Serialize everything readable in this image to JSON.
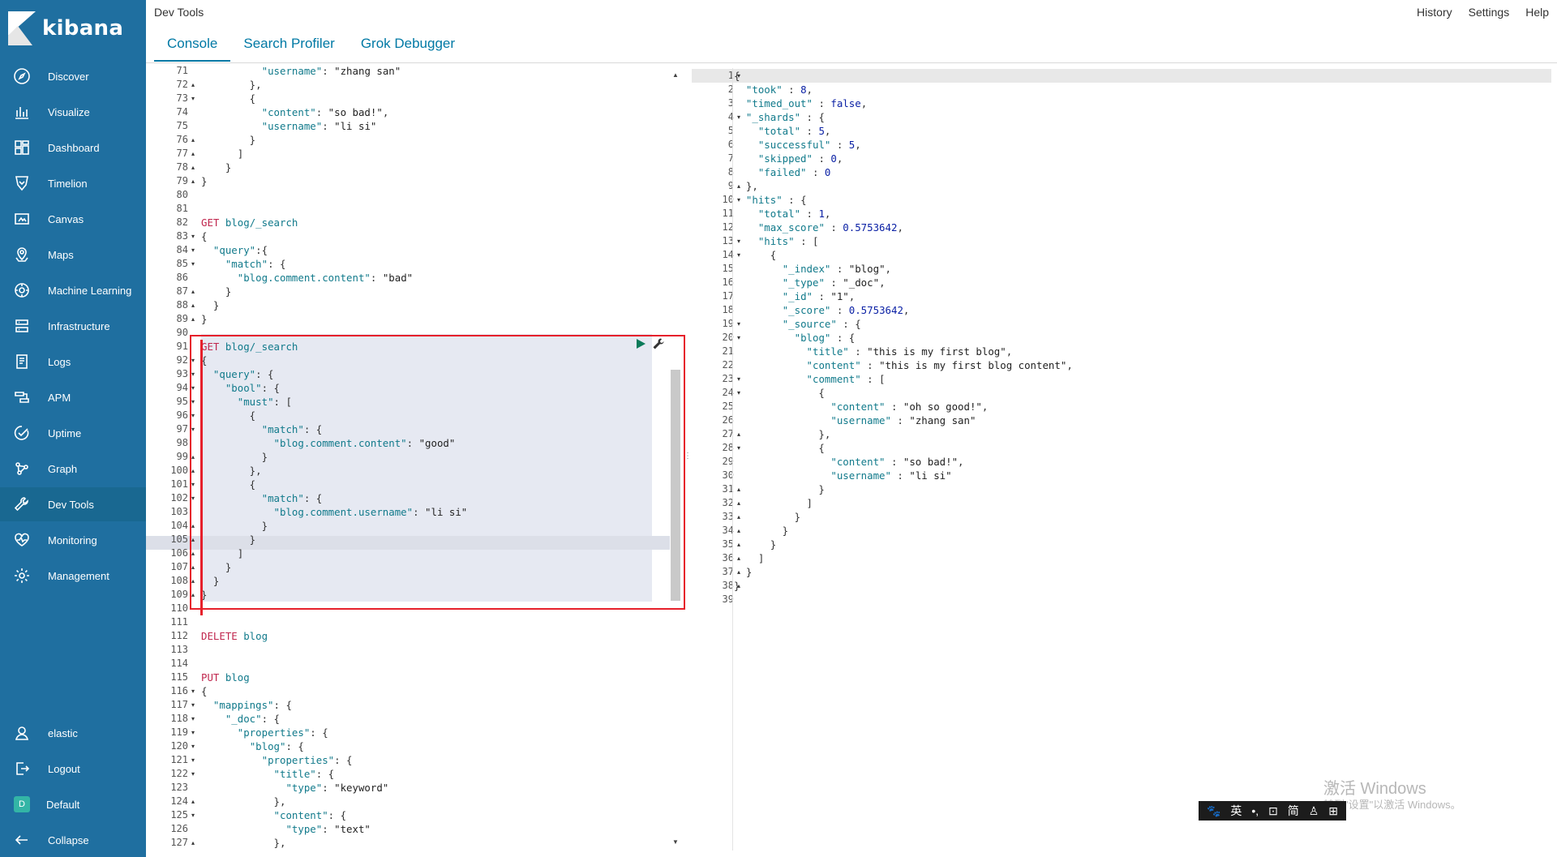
{
  "app": {
    "logo_text": "kibana",
    "section_title": "Dev Tools"
  },
  "header": {
    "links": [
      "History",
      "Settings",
      "Help"
    ],
    "tabs": [
      "Console",
      "Search Profiler",
      "Grok Debugger"
    ],
    "active_tab": "Console"
  },
  "sidebar": {
    "items": [
      {
        "label": "Discover",
        "icon": "compass-icon"
      },
      {
        "label": "Visualize",
        "icon": "chart-icon"
      },
      {
        "label": "Dashboard",
        "icon": "dashboard-icon"
      },
      {
        "label": "Timelion",
        "icon": "timelion-icon"
      },
      {
        "label": "Canvas",
        "icon": "canvas-icon"
      },
      {
        "label": "Maps",
        "icon": "map-icon"
      },
      {
        "label": "Machine Learning",
        "icon": "ml-icon"
      },
      {
        "label": "Infrastructure",
        "icon": "infrastructure-icon"
      },
      {
        "label": "Logs",
        "icon": "logs-icon"
      },
      {
        "label": "APM",
        "icon": "apm-icon"
      },
      {
        "label": "Uptime",
        "icon": "uptime-icon"
      },
      {
        "label": "Graph",
        "icon": "graph-icon"
      },
      {
        "label": "Dev Tools",
        "icon": "wrench-icon",
        "active": true
      },
      {
        "label": "Monitoring",
        "icon": "heartbeat-icon"
      },
      {
        "label": "Management",
        "icon": "gear-icon"
      }
    ],
    "bottom_items": [
      {
        "label": "elastic",
        "icon": "user-icon"
      },
      {
        "label": "Logout",
        "icon": "logout-icon"
      },
      {
        "label": "Default",
        "icon": "space-badge",
        "badge": "D"
      },
      {
        "label": "Collapse",
        "icon": "arrow-left-icon"
      }
    ]
  },
  "request_editor": {
    "lines": [
      {
        "n": "71",
        "f": "",
        "t": "          \"username\": \"zhang san\""
      },
      {
        "n": "72",
        "f": "▴",
        "t": "        },"
      },
      {
        "n": "73",
        "f": "▾",
        "t": "        {"
      },
      {
        "n": "74",
        "f": "",
        "t": "          \"content\": \"so bad!\","
      },
      {
        "n": "75",
        "f": "",
        "t": "          \"username\": \"li si\""
      },
      {
        "n": "76",
        "f": "▴",
        "t": "        }"
      },
      {
        "n": "77",
        "f": "▴",
        "t": "      ]"
      },
      {
        "n": "78",
        "f": "▴",
        "t": "    }"
      },
      {
        "n": "79",
        "f": "▴",
        "t": "}"
      },
      {
        "n": "80",
        "f": "",
        "t": ""
      },
      {
        "n": "81",
        "f": "",
        "t": ""
      },
      {
        "n": "82",
        "f": "",
        "t": "GET blog/_search"
      },
      {
        "n": "83",
        "f": "▾",
        "t": "{"
      },
      {
        "n": "84",
        "f": "▾",
        "t": "  \"query\":{"
      },
      {
        "n": "85",
        "f": "▾",
        "t": "    \"match\": {"
      },
      {
        "n": "86",
        "f": "",
        "t": "      \"blog.comment.content\": \"bad\""
      },
      {
        "n": "87",
        "f": "▴",
        "t": "    }"
      },
      {
        "n": "88",
        "f": "▴",
        "t": "  }"
      },
      {
        "n": "89",
        "f": "▴",
        "t": "}"
      },
      {
        "n": "90",
        "f": "",
        "t": ""
      },
      {
        "n": "91",
        "f": "",
        "t": "GET blog/_search"
      },
      {
        "n": "92",
        "f": "▾",
        "t": "{"
      },
      {
        "n": "93",
        "f": "▾",
        "t": "  \"query\": {"
      },
      {
        "n": "94",
        "f": "▾",
        "t": "    \"bool\": {"
      },
      {
        "n": "95",
        "f": "▾",
        "t": "      \"must\": ["
      },
      {
        "n": "96",
        "f": "▾",
        "t": "        {"
      },
      {
        "n": "97",
        "f": "▾",
        "t": "          \"match\": {"
      },
      {
        "n": "98",
        "f": "",
        "t": "            \"blog.comment.content\": \"good\""
      },
      {
        "n": "99",
        "f": "▴",
        "t": "          }"
      },
      {
        "n": "100",
        "f": "▴",
        "t": "        },"
      },
      {
        "n": "101",
        "f": "▾",
        "t": "        {"
      },
      {
        "n": "102",
        "f": "▾",
        "t": "          \"match\": {"
      },
      {
        "n": "103",
        "f": "",
        "t": "            \"blog.comment.username\": \"li si\""
      },
      {
        "n": "104",
        "f": "▴",
        "t": "          }"
      },
      {
        "n": "105",
        "f": "▴",
        "t": "        }"
      },
      {
        "n": "106",
        "f": "▴",
        "t": "      ]"
      },
      {
        "n": "107",
        "f": "▴",
        "t": "    }"
      },
      {
        "n": "108",
        "f": "▴",
        "t": "  }"
      },
      {
        "n": "109",
        "f": "▴",
        "t": "}"
      },
      {
        "n": "110",
        "f": "",
        "t": ""
      },
      {
        "n": "111",
        "f": "",
        "t": ""
      },
      {
        "n": "112",
        "f": "",
        "t": "DELETE blog"
      },
      {
        "n": "113",
        "f": "",
        "t": ""
      },
      {
        "n": "114",
        "f": "",
        "t": ""
      },
      {
        "n": "115",
        "f": "",
        "t": "PUT blog"
      },
      {
        "n": "116",
        "f": "▾",
        "t": "{"
      },
      {
        "n": "117",
        "f": "▾",
        "t": "  \"mappings\": {"
      },
      {
        "n": "118",
        "f": "▾",
        "t": "    \"_doc\": {"
      },
      {
        "n": "119",
        "f": "▾",
        "t": "      \"properties\": {"
      },
      {
        "n": "120",
        "f": "▾",
        "t": "        \"blog\": {"
      },
      {
        "n": "121",
        "f": "▾",
        "t": "          \"properties\": {"
      },
      {
        "n": "122",
        "f": "▾",
        "t": "            \"title\": {"
      },
      {
        "n": "123",
        "f": "",
        "t": "              \"type\": \"keyword\""
      },
      {
        "n": "124",
        "f": "▴",
        "t": "            },"
      },
      {
        "n": "125",
        "f": "▾",
        "t": "            \"content\": {"
      },
      {
        "n": "126",
        "f": "",
        "t": "              \"type\": \"text\""
      },
      {
        "n": "127",
        "f": "▴",
        "t": "            },"
      }
    ]
  },
  "response_viewer": {
    "lines": [
      {
        "n": "1",
        "f": "▾",
        "t": "{"
      },
      {
        "n": "2",
        "f": "",
        "t": "  \"took\" : 8,"
      },
      {
        "n": "3",
        "f": "",
        "t": "  \"timed_out\" : false,"
      },
      {
        "n": "4",
        "f": "▾",
        "t": "  \"_shards\" : {"
      },
      {
        "n": "5",
        "f": "",
        "t": "    \"total\" : 5,"
      },
      {
        "n": "6",
        "f": "",
        "t": "    \"successful\" : 5,"
      },
      {
        "n": "7",
        "f": "",
        "t": "    \"skipped\" : 0,"
      },
      {
        "n": "8",
        "f": "",
        "t": "    \"failed\" : 0"
      },
      {
        "n": "9",
        "f": "▴",
        "t": "  },"
      },
      {
        "n": "10",
        "f": "▾",
        "t": "  \"hits\" : {"
      },
      {
        "n": "11",
        "f": "",
        "t": "    \"total\" : 1,"
      },
      {
        "n": "12",
        "f": "",
        "t": "    \"max_score\" : 0.5753642,"
      },
      {
        "n": "13",
        "f": "▾",
        "t": "    \"hits\" : ["
      },
      {
        "n": "14",
        "f": "▾",
        "t": "      {"
      },
      {
        "n": "15",
        "f": "",
        "t": "        \"_index\" : \"blog\","
      },
      {
        "n": "16",
        "f": "",
        "t": "        \"_type\" : \"_doc\","
      },
      {
        "n": "17",
        "f": "",
        "t": "        \"_id\" : \"1\","
      },
      {
        "n": "18",
        "f": "",
        "t": "        \"_score\" : 0.5753642,"
      },
      {
        "n": "19",
        "f": "▾",
        "t": "        \"_source\" : {"
      },
      {
        "n": "20",
        "f": "▾",
        "t": "          \"blog\" : {"
      },
      {
        "n": "21",
        "f": "",
        "t": "            \"title\" : \"this is my first blog\","
      },
      {
        "n": "22",
        "f": "",
        "t": "            \"content\" : \"this is my first blog content\","
      },
      {
        "n": "23",
        "f": "▾",
        "t": "            \"comment\" : ["
      },
      {
        "n": "24",
        "f": "▾",
        "t": "              {"
      },
      {
        "n": "25",
        "f": "",
        "t": "                \"content\" : \"oh so good!\","
      },
      {
        "n": "26",
        "f": "",
        "t": "                \"username\" : \"zhang san\""
      },
      {
        "n": "27",
        "f": "▴",
        "t": "              },"
      },
      {
        "n": "28",
        "f": "▾",
        "t": "              {"
      },
      {
        "n": "29",
        "f": "",
        "t": "                \"content\" : \"so bad!\","
      },
      {
        "n": "30",
        "f": "",
        "t": "                \"username\" : \"li si\""
      },
      {
        "n": "31",
        "f": "▴",
        "t": "              }"
      },
      {
        "n": "32",
        "f": "▴",
        "t": "            ]"
      },
      {
        "n": "33",
        "f": "▴",
        "t": "          }"
      },
      {
        "n": "34",
        "f": "▴",
        "t": "        }"
      },
      {
        "n": "35",
        "f": "▴",
        "t": "      }"
      },
      {
        "n": "36",
        "f": "▴",
        "t": "    ]"
      },
      {
        "n": "37",
        "f": "▴",
        "t": "  }"
      },
      {
        "n": "38",
        "f": "▴",
        "t": "}"
      },
      {
        "n": "39",
        "f": "",
        "t": ""
      }
    ]
  },
  "overlay": {
    "watermark_title": "激活 Windows",
    "watermark_sub": "转到\"设置\"以激活 Windows。",
    "ime_items": [
      "🐾",
      "英",
      "•,",
      "⊡",
      "简",
      "♙",
      "⊞"
    ]
  },
  "colors": {
    "sidebar_bg": "#1f6fa0",
    "sidebar_active": "#196891",
    "tab_accent": "#0079a5",
    "highlight_border": "#e6202b",
    "method": "#c0264d",
    "key": "#117a8b",
    "number": "#0b21a5"
  }
}
